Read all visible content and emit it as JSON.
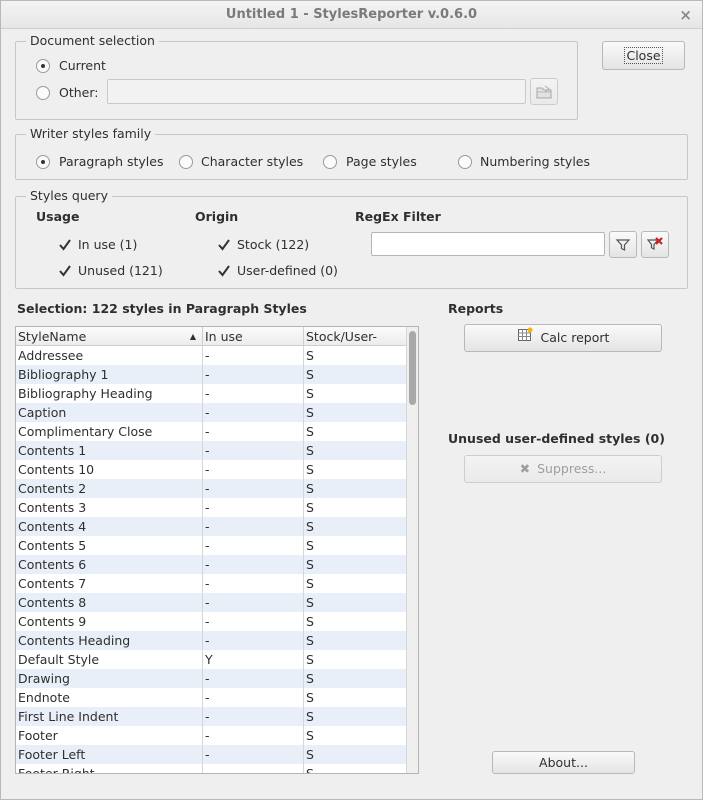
{
  "window": {
    "title": "Untitled 1 - StylesReporter v.0.6.0",
    "close_glyph": "×"
  },
  "doc_selection": {
    "title": "Document selection",
    "current_label": "Current",
    "other_label": "Other:",
    "selected": "current"
  },
  "buttons": {
    "close": "Close",
    "calc_report": "Calc report",
    "suppress": "Suppress...",
    "about": "About..."
  },
  "family": {
    "title": "Writer styles family",
    "options": [
      "Paragraph styles",
      "Character styles",
      "Page styles",
      "Numbering styles"
    ],
    "selected": "Paragraph styles"
  },
  "query": {
    "title": "Styles query",
    "usage_heading": "Usage",
    "origin_heading": "Origin",
    "regex_heading": "RegEx Filter",
    "in_use_label": "In use (1)",
    "unused_label": "Unused (121)",
    "stock_label": "Stock (122)",
    "user_defined_label": "User-defined (0)",
    "in_use_checked": true,
    "unused_checked": true,
    "stock_checked": true,
    "user_defined_checked": true
  },
  "selection_text": "Selection: 122 styles in Paragraph Styles",
  "reports_heading": "Reports",
  "unused_user_heading": "Unused user-defined styles (0)",
  "table": {
    "columns": [
      "StyleName",
      "In use",
      "Stock/User-defined"
    ],
    "rows": [
      [
        "Addressee",
        "-",
        "S"
      ],
      [
        "Bibliography 1",
        "-",
        "S"
      ],
      [
        "Bibliography Heading",
        "-",
        "S"
      ],
      [
        "Caption",
        "-",
        "S"
      ],
      [
        "Complimentary Close",
        "-",
        "S"
      ],
      [
        "Contents 1",
        "-",
        "S"
      ],
      [
        "Contents 10",
        "-",
        "S"
      ],
      [
        "Contents 2",
        "-",
        "S"
      ],
      [
        "Contents 3",
        "-",
        "S"
      ],
      [
        "Contents 4",
        "-",
        "S"
      ],
      [
        "Contents 5",
        "-",
        "S"
      ],
      [
        "Contents 6",
        "-",
        "S"
      ],
      [
        "Contents 7",
        "-",
        "S"
      ],
      [
        "Contents 8",
        "-",
        "S"
      ],
      [
        "Contents 9",
        "-",
        "S"
      ],
      [
        "Contents Heading",
        "-",
        "S"
      ],
      [
        "Default Style",
        "Y",
        "S"
      ],
      [
        "Drawing",
        "-",
        "S"
      ],
      [
        "Endnote",
        "-",
        "S"
      ],
      [
        "First Line Indent",
        "-",
        "S"
      ],
      [
        "Footer",
        "-",
        "S"
      ],
      [
        "Footer Left",
        "-",
        "S"
      ],
      [
        "Footer Right",
        "-",
        "S"
      ]
    ]
  }
}
